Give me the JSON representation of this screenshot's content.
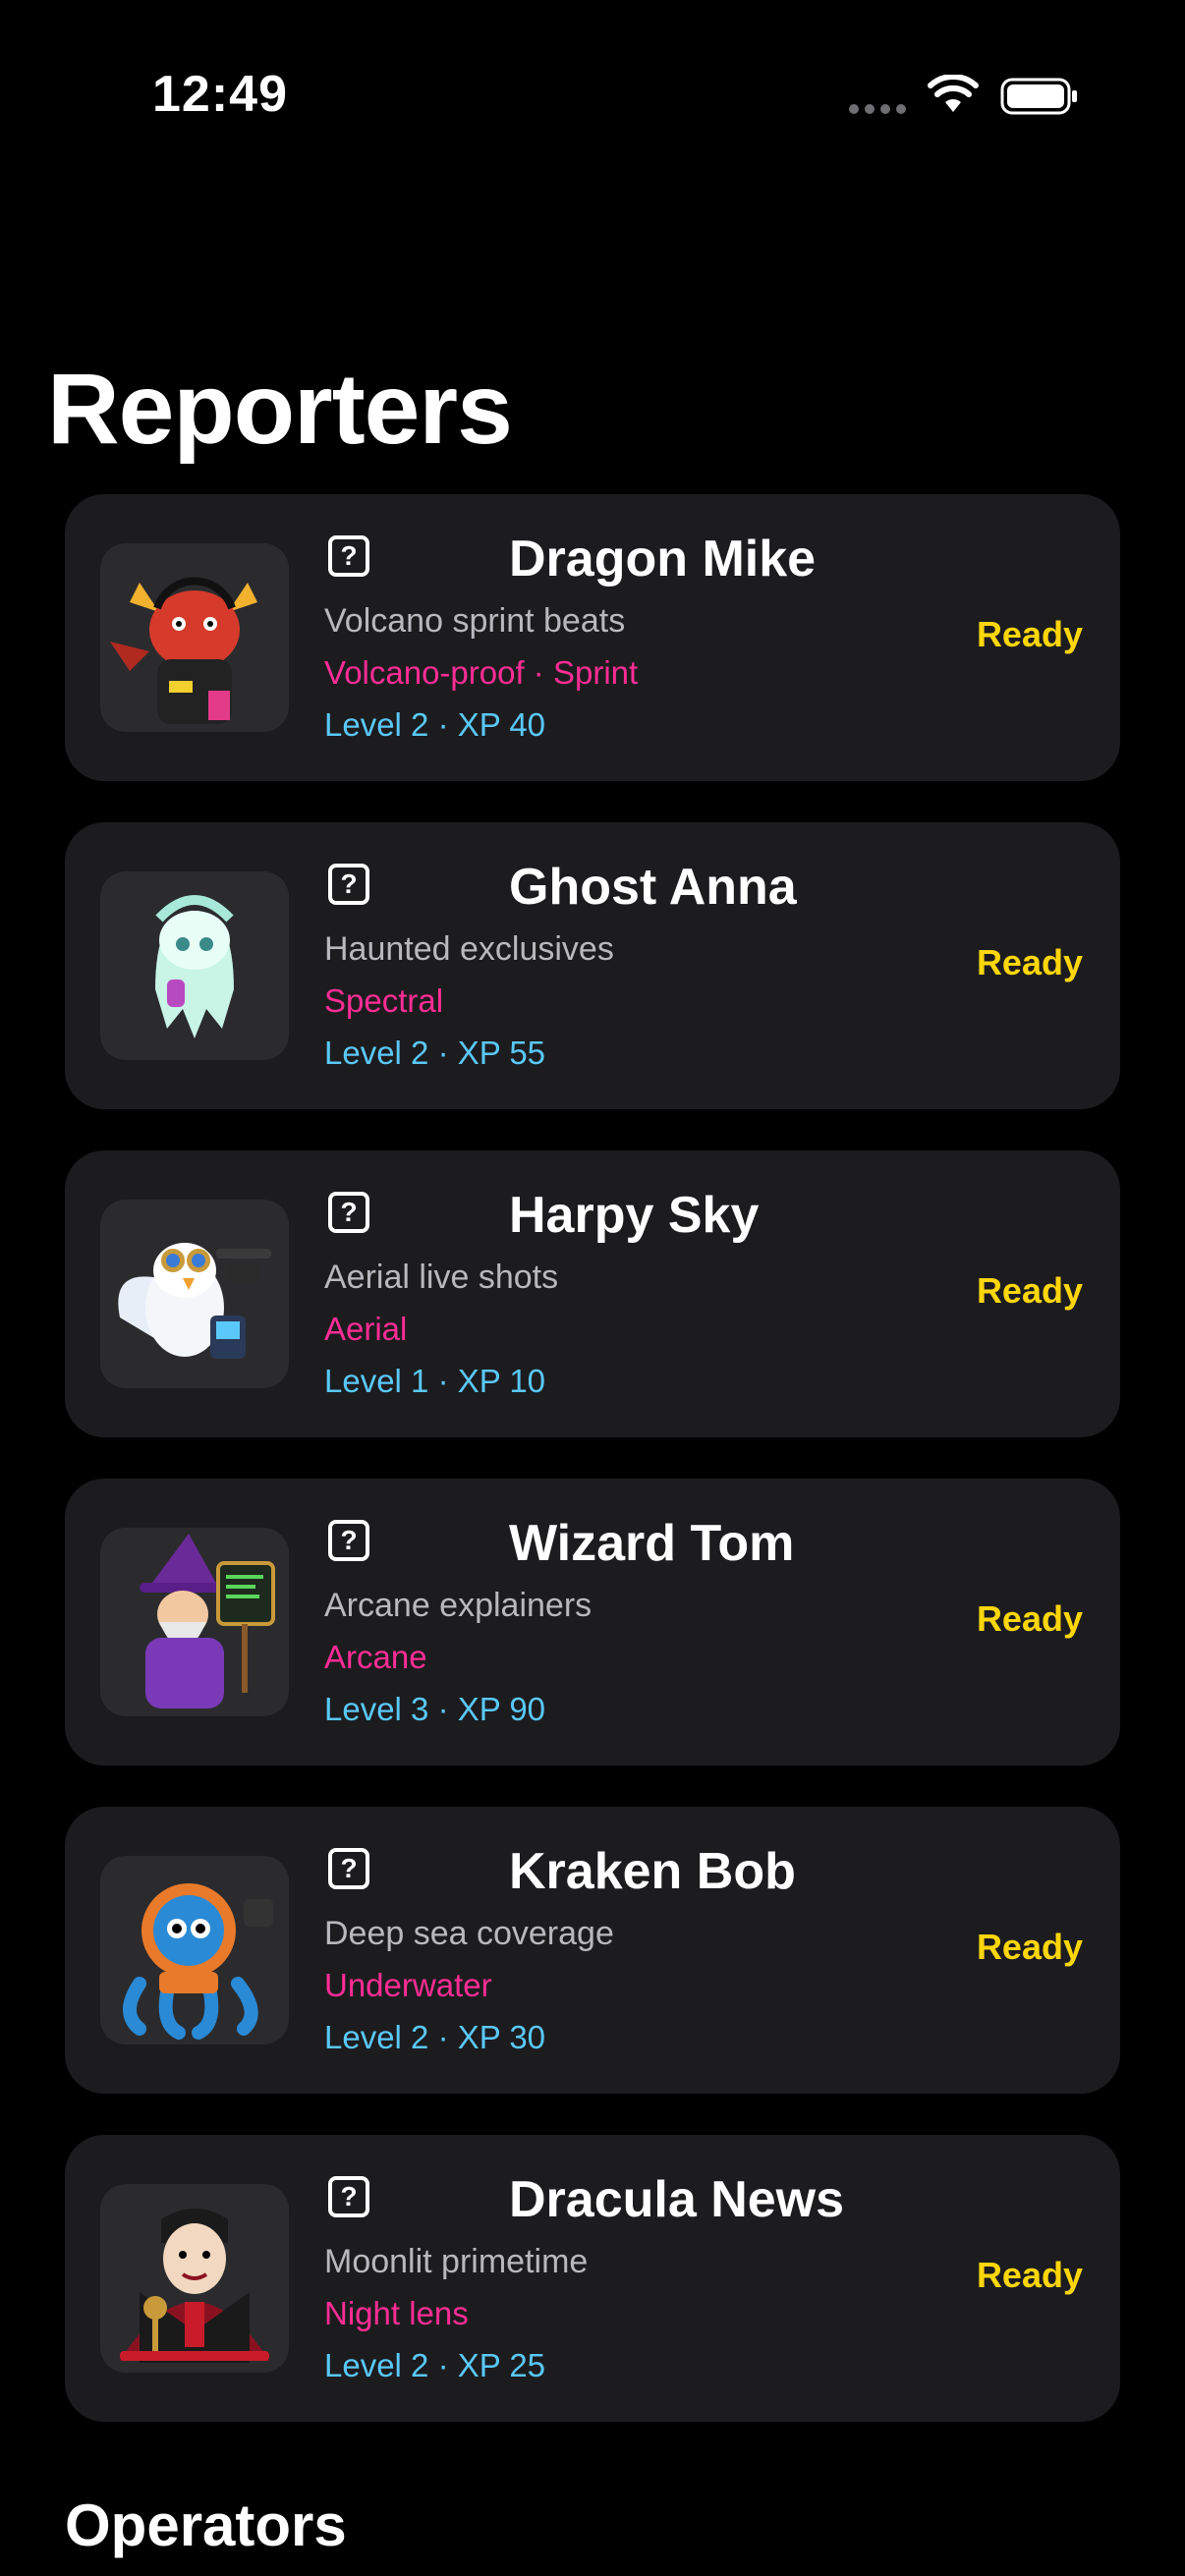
{
  "status_bar": {
    "time": "12:49"
  },
  "page_title": "Reporters",
  "reporters": [
    {
      "name": "Dragon Mike",
      "subtitle": "Volcano sprint beats",
      "traits": "Volcano-proof · Sprint",
      "level": "Level 2 · XP 40",
      "state": "Ready",
      "badge_glyph": "?",
      "avatar_icon": "dragon-avatar",
      "color": "#d63a2a"
    },
    {
      "name": "Ghost Anna",
      "subtitle": "Haunted exclusives",
      "traits": "Spectral",
      "level": "Level 2 · XP 55",
      "state": "Ready",
      "badge_glyph": "?",
      "avatar_icon": "ghost-avatar",
      "color": "#b8f0e0"
    },
    {
      "name": "Harpy Sky",
      "subtitle": "Aerial live shots",
      "traits": "Aerial",
      "level": "Level 1 · XP 10",
      "state": "Ready",
      "badge_glyph": "?",
      "avatar_icon": "harpy-avatar",
      "color": "#3a7bd5"
    },
    {
      "name": "Wizard Tom",
      "subtitle": "Arcane explainers",
      "traits": "Arcane",
      "level": "Level 3 · XP 90",
      "state": "Ready",
      "badge_glyph": "?",
      "avatar_icon": "wizard-avatar",
      "color": "#7a3ab8"
    },
    {
      "name": "Kraken Bob",
      "subtitle": "Deep sea coverage",
      "traits": "Underwater",
      "level": "Level 2 · XP 30",
      "state": "Ready",
      "badge_glyph": "?",
      "avatar_icon": "kraken-avatar",
      "color": "#2a8ad6"
    },
    {
      "name": "Dracula News",
      "subtitle": "Moonlit primetime",
      "traits": "Night lens",
      "level": "Level 2 · XP 25",
      "state": "Ready",
      "badge_glyph": "?",
      "avatar_icon": "dracula-avatar",
      "color": "#b81c2a"
    }
  ],
  "section_operators": "Operators",
  "colors": {
    "background": "#000000",
    "card": "#1c1c1e",
    "traits": "#ff2d95",
    "level": "#5ac8fa",
    "state": "#ffd60a",
    "subtitle": "#b8b8bd"
  }
}
